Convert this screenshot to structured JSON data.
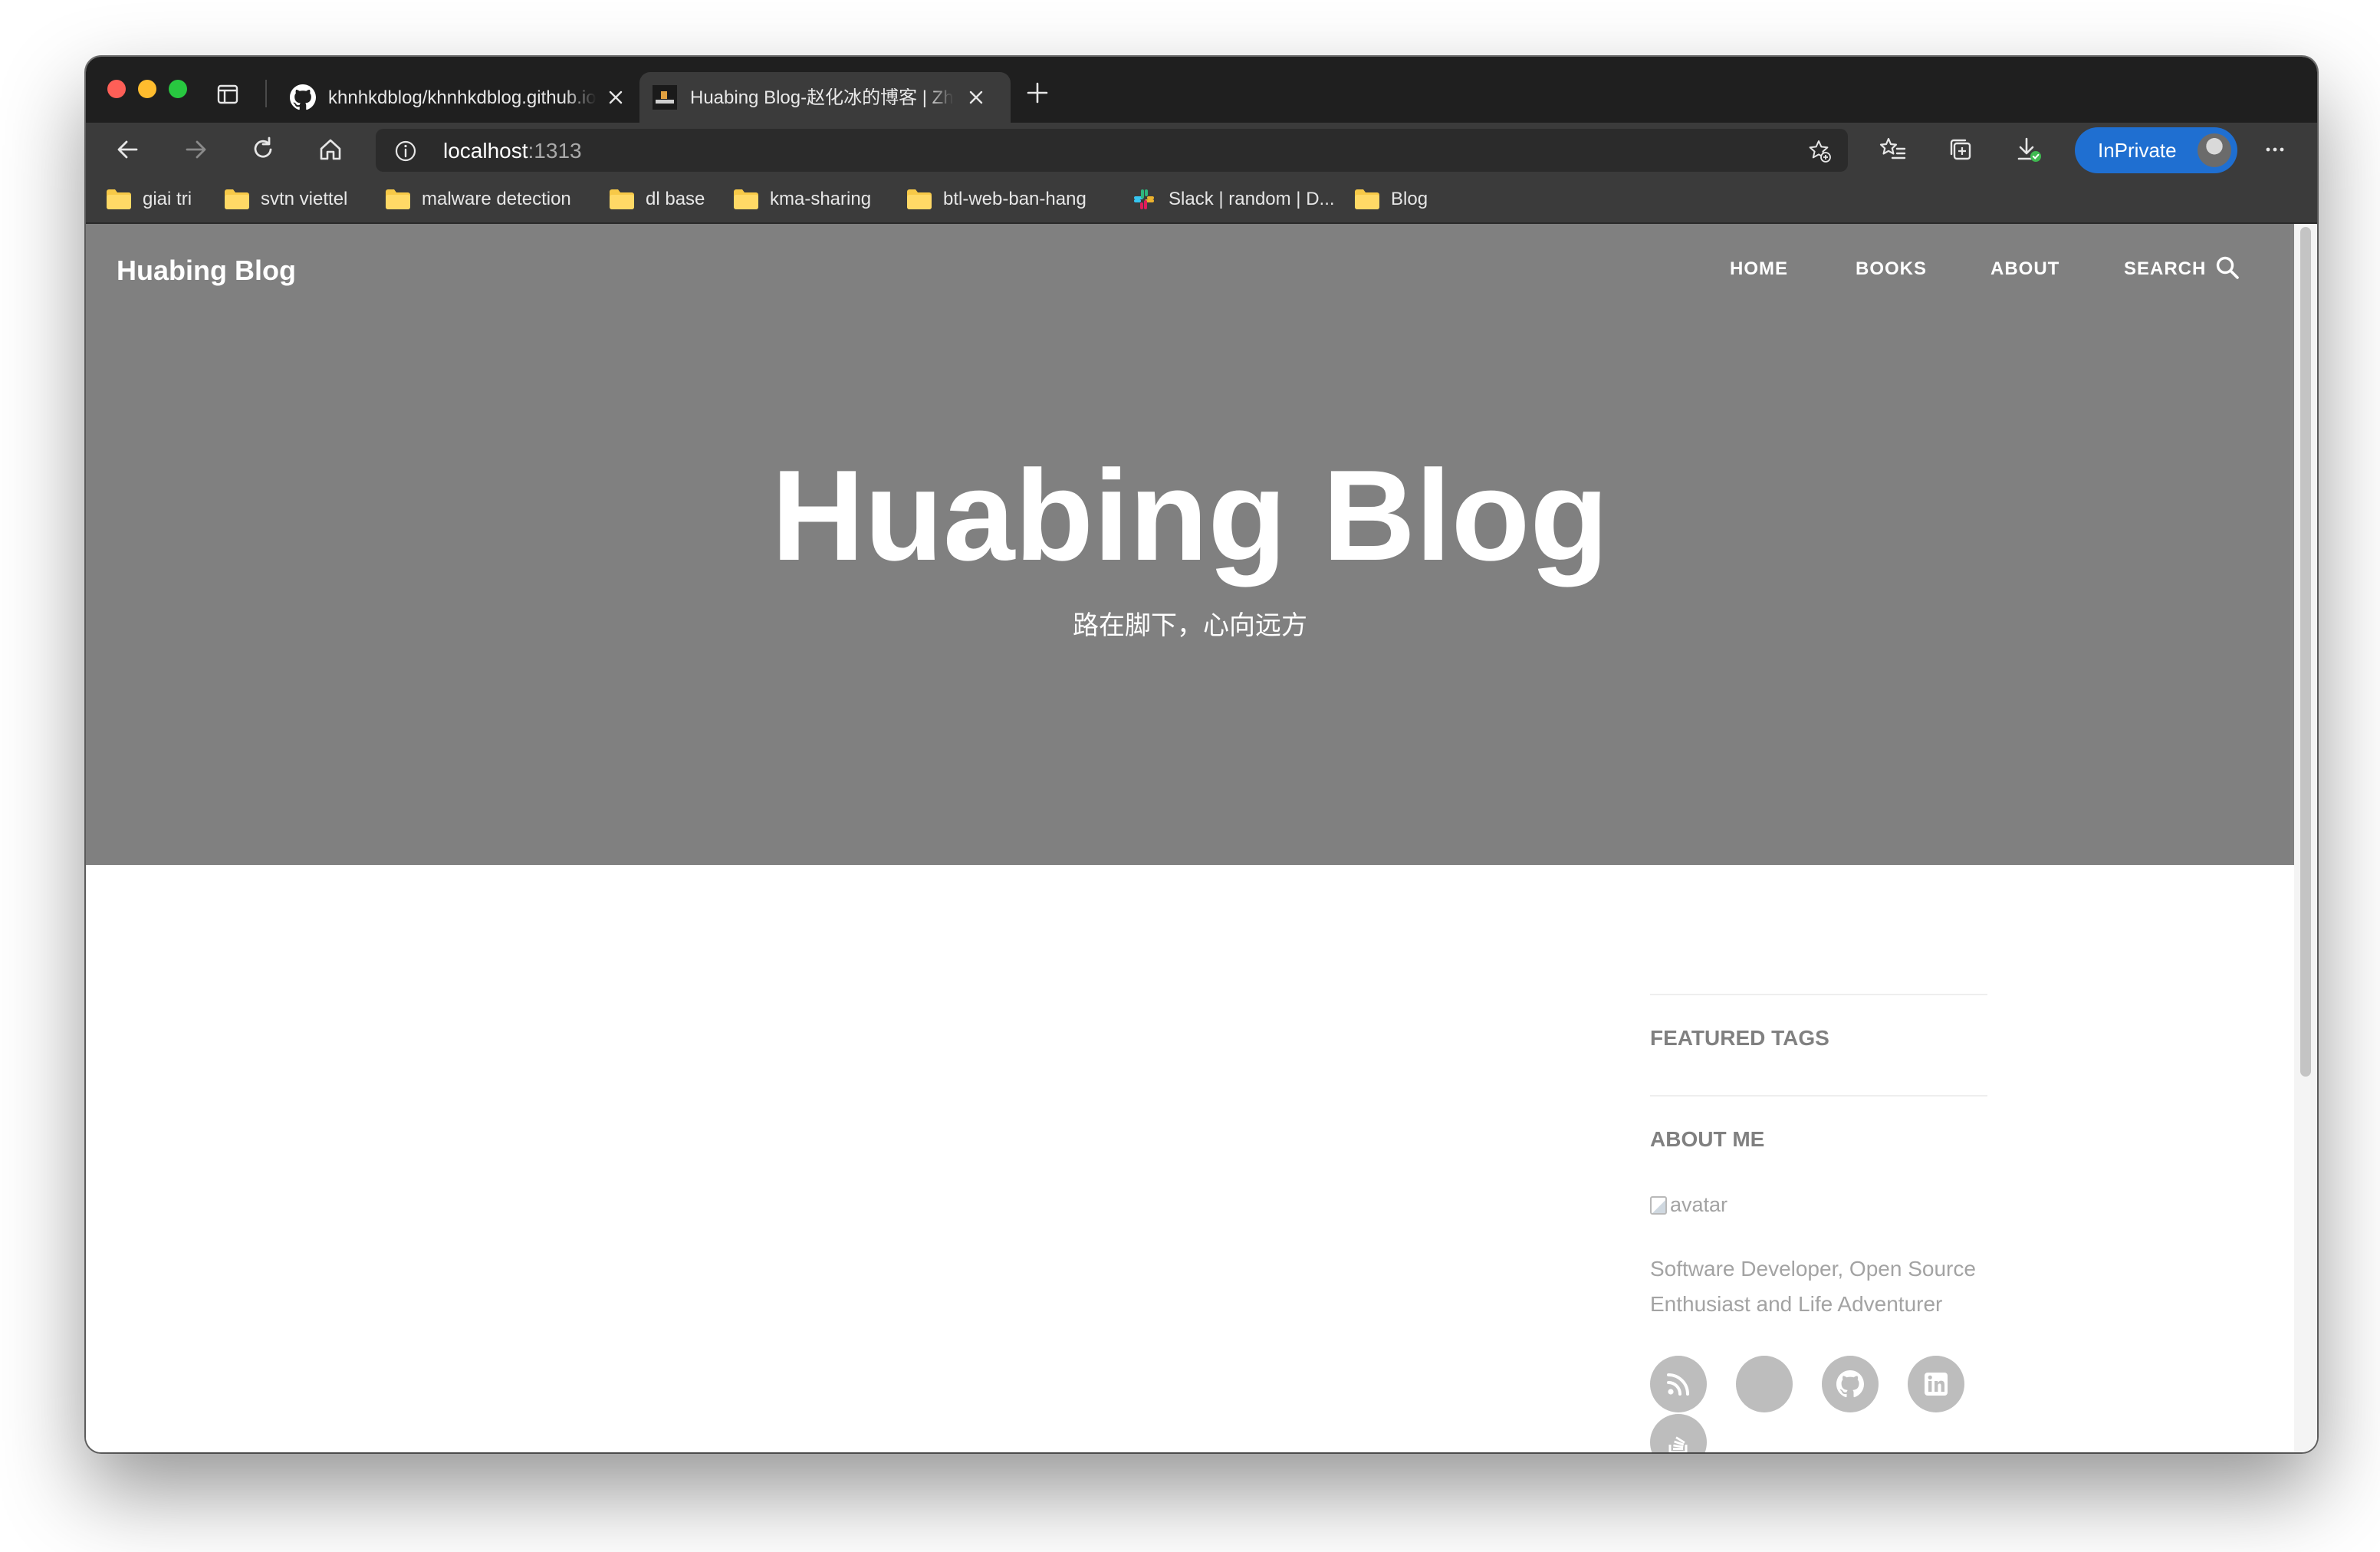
{
  "browser": {
    "tabs": [
      {
        "label": "khnhkdblog/khnhkdblog.github.io",
        "favicon": "github-icon"
      },
      {
        "label": "Huabing Blog-赵化冰的博客 | Zhaohuabing Blog",
        "favicon": "site-favicon-icon"
      }
    ],
    "address": {
      "host": "localhost",
      "port": ":1313"
    },
    "inprivate_label": "InPrivate",
    "bookmarks": [
      {
        "label": "giai tri",
        "icon": "folder-icon"
      },
      {
        "label": "svtn viettel",
        "icon": "folder-icon"
      },
      {
        "label": "malware detection",
        "icon": "folder-icon"
      },
      {
        "label": "dl base",
        "icon": "folder-icon"
      },
      {
        "label": "kma-sharing",
        "icon": "folder-icon"
      },
      {
        "label": "btl-web-ban-hang",
        "icon": "folder-icon"
      },
      {
        "label": "Slack | random | D...",
        "icon": "slack-icon"
      },
      {
        "label": "Blog",
        "icon": "folder-icon"
      }
    ]
  },
  "site": {
    "brand": "Huabing Blog",
    "nav": {
      "home": "HOME",
      "books": "BOOKS",
      "about": "ABOUT",
      "search": "SEARCH"
    },
    "hero": {
      "title": "Huabing Blog",
      "subtitle": "路在脚下，心向远方"
    },
    "hero_color": "#808080"
  },
  "sidebar": {
    "featured_tags_heading": "FEATURED TAGS",
    "about_me_heading": "ABOUT ME",
    "avatar_alt": "avatar",
    "bio": "Software Developer, Open Source Enthusiast and Life Adventurer",
    "social_links": [
      "rss-icon",
      "blank-icon",
      "github-icon",
      "linkedin-icon",
      "stackoverflow-icon"
    ]
  },
  "colors": {
    "accent": "#1f6fd1",
    "chrome_dark": "#1f1f1f",
    "chrome": "#3b3b3b"
  }
}
